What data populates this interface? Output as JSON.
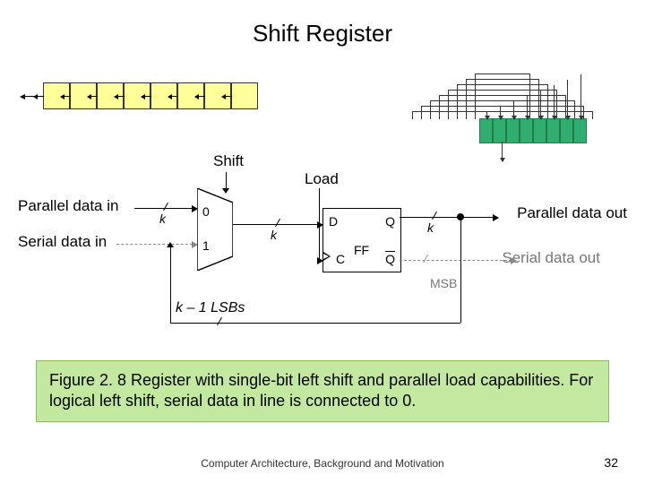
{
  "title": "Shift Register",
  "labels": {
    "shift": "Shift",
    "load": "Load",
    "parallel_in": "Parallel data in",
    "serial_in": "Serial data in",
    "parallel_out": "Parallel data out",
    "serial_out": "Serial data out",
    "k": "k",
    "kminus1": "k – 1 LSBs",
    "msb": "MSB",
    "mux0": "0",
    "mux1": "1",
    "d": "D",
    "q": "Q",
    "qbar": "Q",
    "c": "C",
    "ff": "FF"
  },
  "caption": "Figure 2. 8    Register with single-bit left shift and parallel load capabilities. For logical left shift, serial data in line is connected to 0.",
  "footer": "Computer Architecture, Background and Motivation",
  "page": "32",
  "yellow_cells": 8,
  "green_cells": 8
}
